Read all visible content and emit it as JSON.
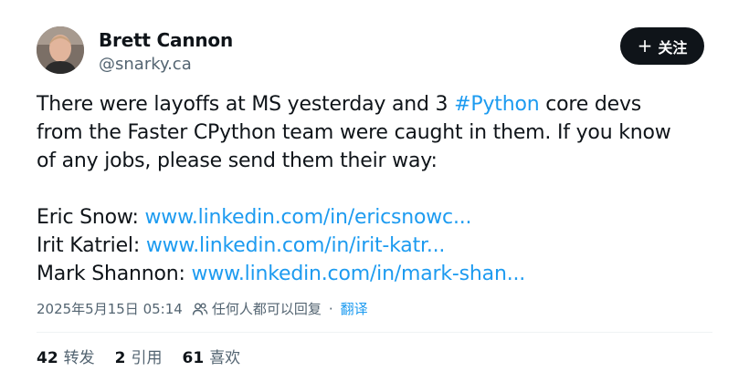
{
  "author": {
    "name": "Brett Cannon",
    "handle": "@snarky.ca"
  },
  "follow_button": {
    "label": "关注",
    "icon": "plus-icon"
  },
  "post": {
    "line1": {
      "a": "There were layoffs at MS yesterday and 3 ",
      "hashtag": "#Python",
      "b": " core devs"
    },
    "line2": "from the Faster CPython team were caught in them. If you know",
    "line3": "of any jobs, please send them their way:",
    "contacts": [
      {
        "label": "Eric Snow: ",
        "link": "www.linkedin.com/in/ericsnowc..."
      },
      {
        "label": "Irit Katriel: ",
        "link": "www.linkedin.com/in/irit-katr..."
      },
      {
        "label": "Mark Shannon: ",
        "link": "www.linkedin.com/in/mark-shan..."
      }
    ]
  },
  "meta": {
    "timestamp": "2025年5月15日 05:14",
    "reply_setting": "任何人都可以回复",
    "separator": "·",
    "translate": "翻译",
    "reply_icon": "people-icon"
  },
  "stats": {
    "reposts": {
      "count": "42",
      "label": "转发"
    },
    "quotes": {
      "count": "2",
      "label": "引用"
    },
    "likes": {
      "count": "61",
      "label": "喜欢"
    }
  },
  "colors": {
    "link": "#1d9bf0",
    "text": "#0f1419",
    "muted": "#536471",
    "button": "#0f1419"
  }
}
